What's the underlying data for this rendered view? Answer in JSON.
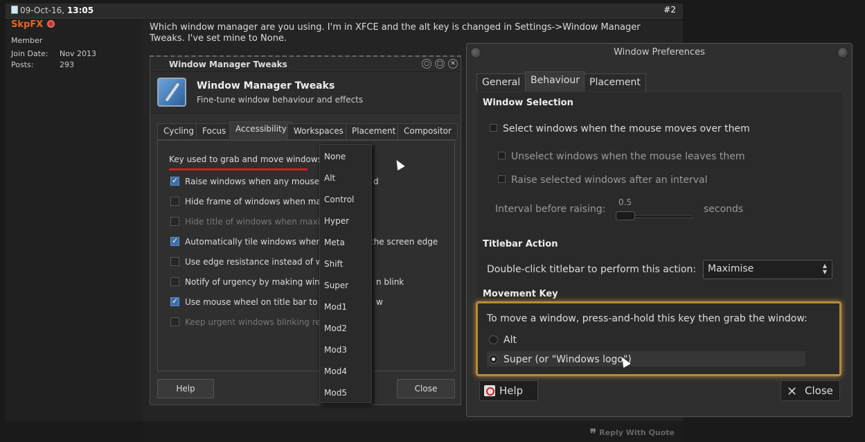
{
  "post": {
    "date": "09-Oct-16,",
    "time": "13:05",
    "number": "#2",
    "username": "SkpFX",
    "rank": "Member",
    "join_label": "Join Date:",
    "join_value": "Nov 2013",
    "posts_label": "Posts:",
    "posts_value": "293",
    "text": "Which window manager are you using. I'm in XFCE and the alt key is changed in Settings->Window Manager Tweaks. I've set mine to None.",
    "reply_quote": "Reply With Quote"
  },
  "wmt": {
    "window_title": "Window Manager Tweaks",
    "heading": "Window Manager Tweaks",
    "subheading": "Fine-tune window behaviour and effects",
    "tabs": [
      "Cycling",
      "Focus",
      "Accessibility",
      "Workspaces",
      "Placement",
      "Compositor"
    ],
    "key_label": "Key used to grab and move windows:",
    "options": [
      {
        "label": "Raise windows when any mouse bu",
        "suffix": "d",
        "checked": true
      },
      {
        "label": "Hide frame of windows when maxin",
        "suffix": "",
        "checked": false
      },
      {
        "label": "Hide title of windows when maximi",
        "suffix": "",
        "checked": false,
        "disabled": true
      },
      {
        "label": "Automatically tile windows when m",
        "suffix": "the screen edge",
        "checked": true
      },
      {
        "label": "Use edge resistance instead of win",
        "suffix": "",
        "checked": false
      },
      {
        "label": "Notify of urgency by making window",
        "suffix": "n blink",
        "checked": false
      },
      {
        "label": "Use mouse wheel on title bar to rol",
        "suffix": "w",
        "checked": true
      },
      {
        "label": "Keep urgent windows blinking repe",
        "suffix": "",
        "checked": false,
        "disabled": true
      }
    ],
    "help_label": "Help",
    "close_label": "Close",
    "dropdown": [
      "None",
      "Alt",
      "Control",
      "Hyper",
      "Meta",
      "Shift",
      "Super",
      "Mod1",
      "Mod2",
      "Mod3",
      "Mod4",
      "Mod5"
    ]
  },
  "wp": {
    "window_title": "Window Preferences",
    "tabs": [
      "General",
      "Behaviour",
      "Placement"
    ],
    "window_selection": "Window Selection",
    "select_windows": "Select windows when the mouse moves over them",
    "unselect_windows": "Unselect windows when the mouse leaves them",
    "raise_selected": "Raise selected windows after an interval",
    "interval_label": "Interval before raising:",
    "interval_value": "0.5",
    "interval_unit": "seconds",
    "titlebar_action": "Titlebar Action",
    "double_click_label": "Double-click titlebar to perform this action:",
    "double_click_value": "Maximise",
    "movement_key": "Movement Key",
    "move_instruction": "To move a window, press-and-hold this key then grab the window:",
    "radio_alt": "Alt",
    "radio_super": "Super (or \"Windows logo\")",
    "help_label": "Help",
    "close_label": "Close"
  }
}
